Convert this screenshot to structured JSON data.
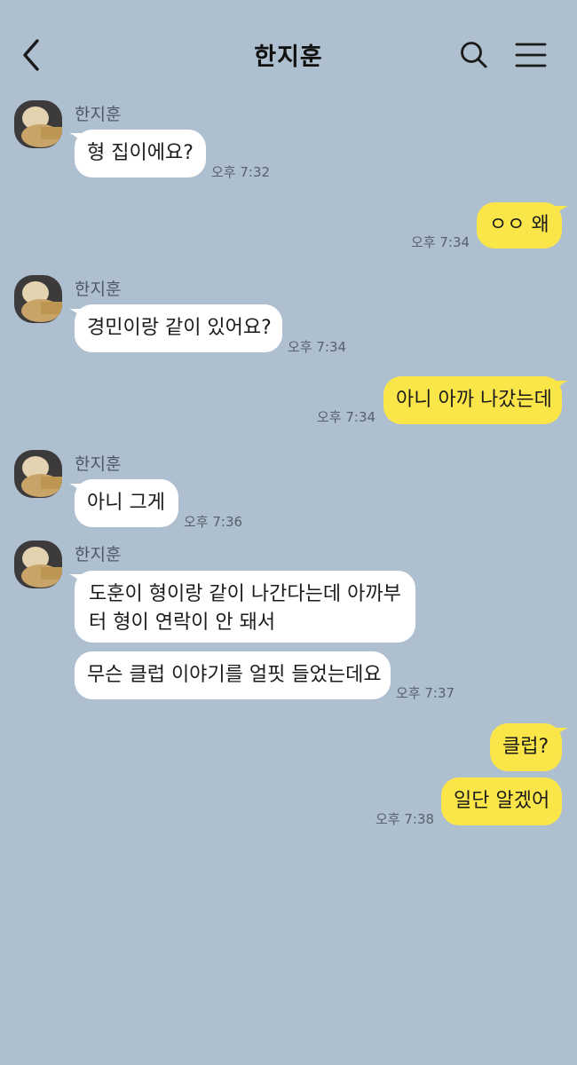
{
  "header": {
    "title": "한지훈"
  },
  "colors": {
    "background": "#aebfcf",
    "incoming_bubble": "#ffffff",
    "outgoing_bubble": "#fbe64a"
  },
  "messages": [
    {
      "sender": "한지훈",
      "text": "형 집이에요?",
      "time": "오후 7:32"
    },
    {
      "text": "ㅇㅇ 왜",
      "time": "오후 7:34"
    },
    {
      "sender": "한지훈",
      "text": "경민이랑 같이 있어요?",
      "time": "오후 7:34"
    },
    {
      "text": "아니 아까 나갔는데",
      "time": "오후 7:34"
    },
    {
      "sender": "한지훈",
      "text": "아니 그게",
      "time": "오후 7:36"
    },
    {
      "sender": "한지훈",
      "lines": [
        "도훈이 형이랑 같이 나간다는데 아까부",
        "터 형이 연락이 안 돼서"
      ]
    },
    {
      "text": "무슨 클럽 이야기를 얼핏 들었는데요",
      "time": "오후 7:37"
    },
    {
      "text": "클럽?"
    },
    {
      "text": "일단 알겠어",
      "time": "오후 7:38"
    }
  ]
}
